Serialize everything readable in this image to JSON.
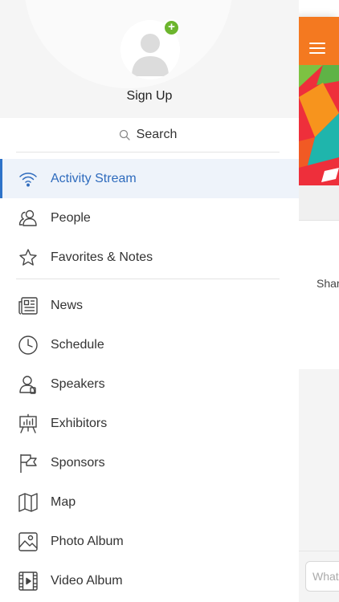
{
  "profile": {
    "signup_label": "Sign Up",
    "add_badge": "+"
  },
  "search": {
    "label": "Search"
  },
  "menu_primary": [
    {
      "label": "Activity Stream",
      "icon": "wifi-icon",
      "active": true
    },
    {
      "label": "People",
      "icon": "people-icon"
    },
    {
      "label": "Favorites & Notes",
      "icon": "star-icon"
    }
  ],
  "menu_secondary": [
    {
      "label": "News",
      "icon": "newspaper-icon"
    },
    {
      "label": "Schedule",
      "icon": "clock-icon"
    },
    {
      "label": "Speakers",
      "icon": "speaker-person-icon"
    },
    {
      "label": "Exhibitors",
      "icon": "easel-icon"
    },
    {
      "label": "Sponsors",
      "icon": "flag-icon"
    },
    {
      "label": "Map",
      "icon": "map-icon"
    },
    {
      "label": "Photo Album",
      "icon": "photo-icon"
    },
    {
      "label": "Video Album",
      "icon": "film-icon"
    }
  ],
  "main": {
    "card_text": "Shar",
    "compose_placeholder": "What"
  },
  "colors": {
    "accent": "#2e6bbd",
    "topbar": "#f47920",
    "badge": "#6cb52d"
  }
}
